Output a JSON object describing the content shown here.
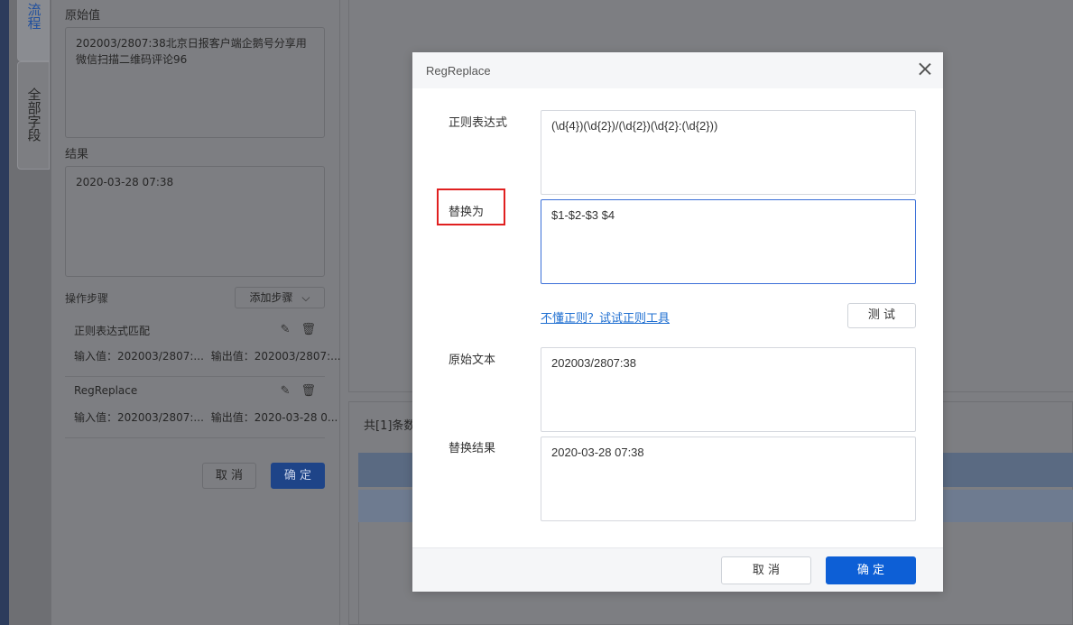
{
  "side_tabs": [
    {
      "label": "流程"
    },
    {
      "label": "全部字段"
    }
  ],
  "left_panel": {
    "original_label": "原始值",
    "original_value": "202003/2807:38北京日报客户端企鹅号分享用微信扫描二维码评论96",
    "result_label": "结果",
    "result_value": "2020-03-28 07:38",
    "steps_label": "操作步骤",
    "add_step_label": "添加步骤",
    "steps": [
      {
        "title": "正则表达式匹配",
        "input": "输入值：202003/2807:...",
        "output": "输出值：202003/2807:..."
      },
      {
        "title": "RegReplace",
        "input": "输入值：202003/2807:...",
        "output": "输出值：2020-03-28 0..."
      }
    ],
    "cancel_label": "取 消",
    "ok_label": "确 定"
  },
  "right_area": {
    "total_text": "共[1]条数"
  },
  "modal": {
    "title": "RegReplace",
    "regex_label": "正则表达式",
    "regex_value": "(\\d{4})(\\d{2})/(\\d{2})(\\d{2}:(\\d{2}))",
    "replace_label": "替换为",
    "replace_value": "$1-$2-$3 $4",
    "regex_tool_link": "不懂正则？试试正则工具",
    "test_label": "测 试",
    "source_label": "原始文本",
    "source_value": "202003/2807:38",
    "result_label": "替换结果",
    "result_value": "2020-03-28 07:38",
    "cancel_label": "取 消",
    "ok_label": "确 定"
  },
  "colors": {
    "primary": "#0d5fd6",
    "link": "#1f6fd1",
    "highlight_frame": "#e02020"
  }
}
